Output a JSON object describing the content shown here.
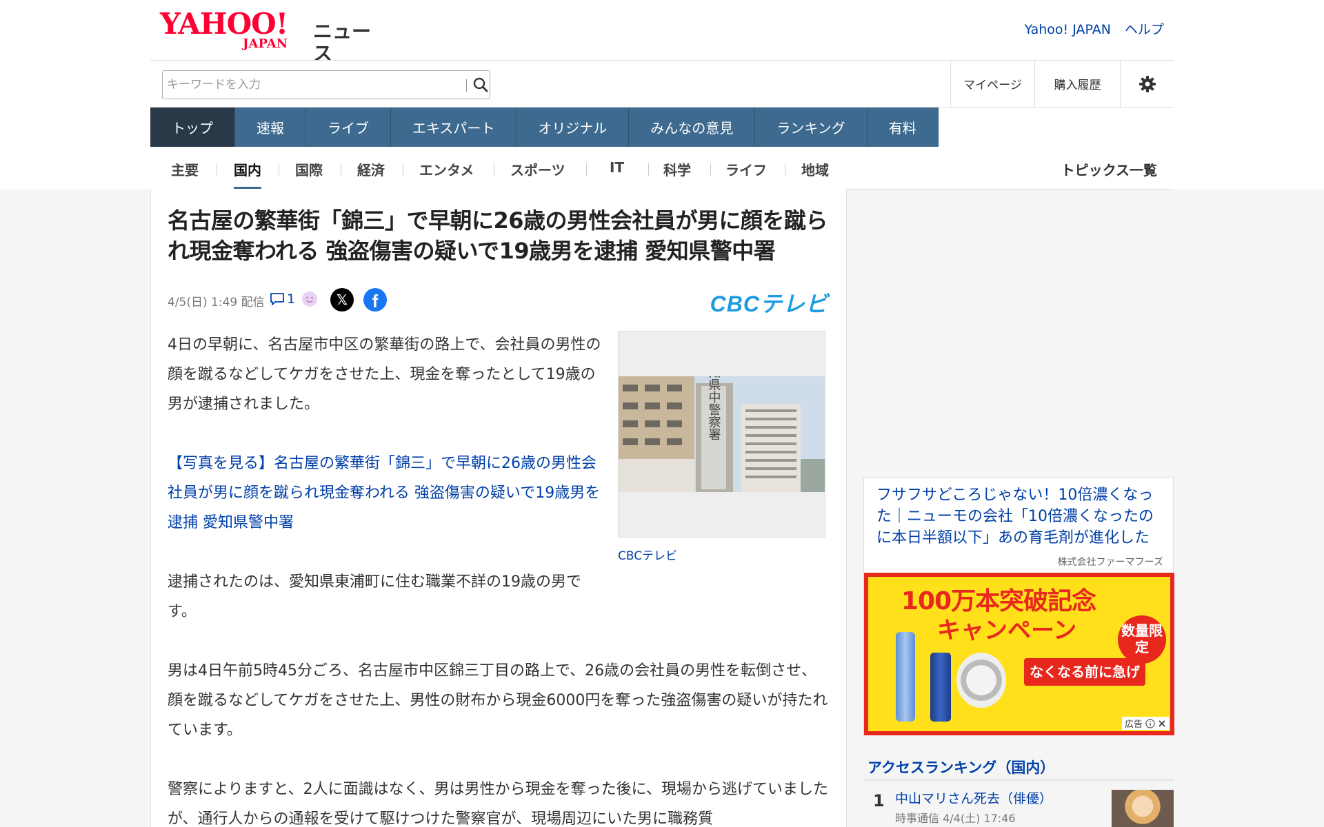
{
  "header": {
    "logo_main": "YAHOO!",
    "logo_sub": "JAPAN",
    "logo_news": "ニュース",
    "links": [
      "Yahoo! JAPAN",
      "ヘルプ"
    ]
  },
  "search": {
    "placeholder": "キーワードを入力"
  },
  "utility": {
    "mypage": "マイページ",
    "purchase_history": "購入履歴"
  },
  "global_nav": [
    "トップ",
    "速報",
    "ライブ",
    "エキスパート",
    "オリジナル",
    "みんなの意見",
    "ランキング",
    "有料"
  ],
  "sub_nav": {
    "items": [
      "主要",
      "国内",
      "国際",
      "経済",
      "エンタメ",
      "スポーツ",
      "IT",
      "科学",
      "ライフ",
      "地域"
    ],
    "active": "国内",
    "topics_link": "トピックス一覧"
  },
  "article": {
    "title": "名古屋の繁華街「錦三」で早朝に26歳の男性会社員が男に顔を蹴られ現金奪われる 強盗傷害の疑いで19歳男を逮捕 愛知県警中署",
    "date": "4/5(日) 1:49 配信",
    "comment_count": "1",
    "source": "CBCテレビ",
    "source_logo": "CBCテレビ",
    "photo_caption": "CBCテレビ",
    "photo_sign": "愛知県中警察署",
    "paragraphs": [
      "4日の早朝に、名古屋市中区の繁華街の路上で、会社員の男性の顔を蹴るなどしてケガをさせた上、現金を奪ったとして19歳の男が逮捕されました。",
      "【写真を見る】名古屋の繁華街「錦三」で早朝に26歳の男性会社員が男に顔を蹴られ現金奪われる 強盗傷害の疑いで19歳男を逮捕 愛知県警中署",
      "逮捕されたのは、愛知県東浦町に住む職業不詳の19歳の男です。",
      "男は4日午前5時45分ごろ、名古屋市中区錦三丁目の路上で、26歳の会社員の男性を転倒させ、顔を蹴るなどしてケガをさせた上、男性の財布から現金6000円を奪った強盗傷害の疑いが持たれています。",
      "警察によりますと、2人に面識はなく、男は男性から現金を奪った後に、現場から逃げていましたが、通行人からの通報を受けて駆けつけた警察官が、現場周辺にいた男に職務質"
    ]
  },
  "sidebar": {
    "ad": {
      "text": "フサフサどころじゃない！10倍濃くなった｜ニューモの会社「10倍濃くなったのに本日半額以下」あの育毛剤が進化した",
      "sponsor": "株式会社ファーマフーズ",
      "image_headline_1": "100万本突破記念",
      "image_headline_2": "キャンペーン",
      "image_badge": "数量限定",
      "image_cta": "なくなる前に急げ",
      "label": "広告"
    },
    "ranking": {
      "heading": "アクセスランキング（国内）",
      "items": [
        {
          "rank": "1",
          "title": "中山マリさん死去（俳優）",
          "source": "時事通信 4/4(土) 17:46"
        }
      ]
    }
  },
  "colors": {
    "brand_red": "#ff0033",
    "nav_blue": "#3d6a8e",
    "link_blue": "#0040a8"
  }
}
